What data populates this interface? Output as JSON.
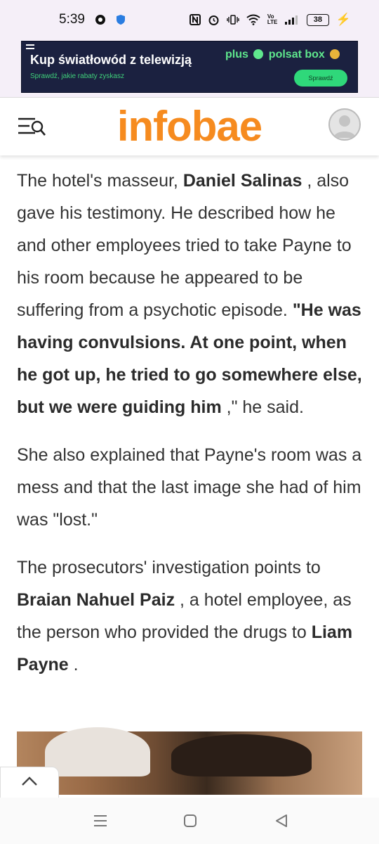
{
  "status_bar": {
    "time": "5:39",
    "network_label": "Vo LTE",
    "battery": "38"
  },
  "ad": {
    "title": "Kup światłowód z telewizją",
    "subtitle": "Sprawdź, jakie rabaty zyskasz",
    "brand_left": "plus",
    "brand_right": "polsat box",
    "cta": "Sprawdź"
  },
  "header": {
    "logo": "infobae"
  },
  "article": {
    "p1": {
      "t1": "The hotel's masseur, ",
      "b1": "Daniel Salinas",
      "t2": " , also gave his testimony. He described how he and other employees tried to take Payne to his room because he appeared to be suffering from a psychotic episode. ",
      "b2": "\"He was having convulsions. At one point, when he got up, he tried to go somewhere else, but we were guiding him",
      "t3": " ,\" he said."
    },
    "p2": "She also explained that Payne's room was a mess and that the last image she had of him was \"lost.\"",
    "p3": {
      "t1": "The prosecutors' investigation points to ",
      "b1": "Braian Nahuel Paiz",
      "t2": " , a hotel employee, as the person who provided the drugs to ",
      "b2": "Liam Payne",
      "t3": " ."
    }
  },
  "icons": {
    "menu_search": "menu-search-icon",
    "avatar": "user-avatar-icon",
    "scroll_top": "chevron-up-icon",
    "nav_recent": "recent-apps-icon",
    "nav_home": "home-icon",
    "nav_back": "back-icon"
  },
  "colors": {
    "brand_orange": "#f68b1f",
    "ad_background": "#1b2140",
    "ad_accent": "#2fd87a"
  }
}
